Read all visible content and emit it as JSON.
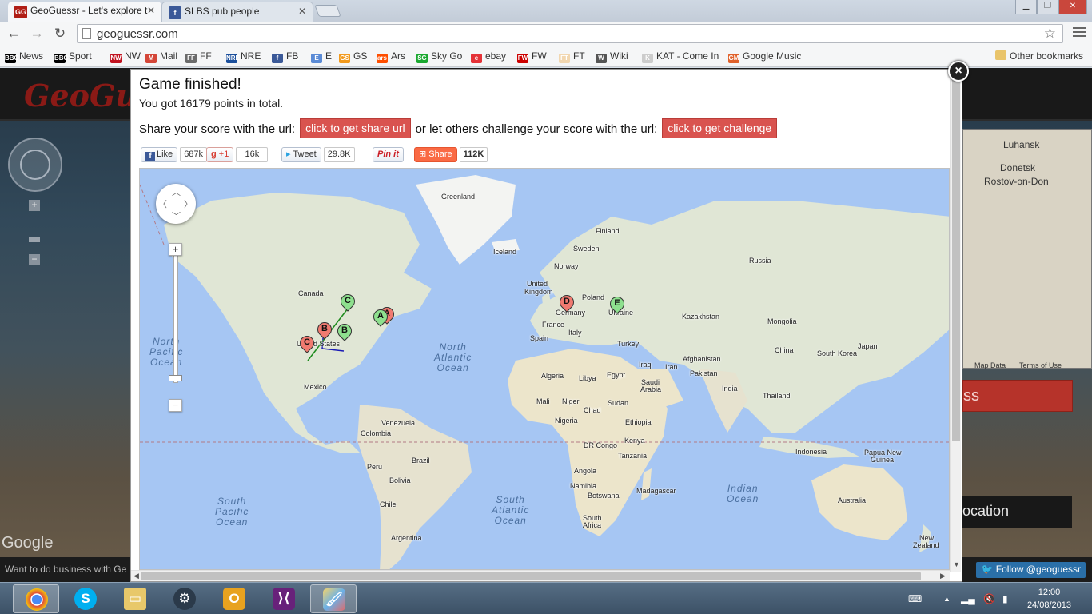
{
  "browser": {
    "tabs": [
      {
        "title": "GeoGuessr - Let's explore t",
        "favicon": "GG"
      },
      {
        "title": "SLBS pub people",
        "favicon": "f"
      }
    ],
    "url": "geoguessr.com",
    "bookmarks": [
      {
        "label": "News",
        "icon": "BBC",
        "color": "#000000"
      },
      {
        "label": "Sport",
        "icon": "BBC",
        "color": "#000000"
      },
      {
        "label": "NW",
        "icon": "NW",
        "color": "#c1121f"
      },
      {
        "label": "Mail",
        "icon": "M",
        "color": "#d44638"
      },
      {
        "label": "FF",
        "icon": "FF",
        "color": "#6b6b6b"
      },
      {
        "label": "NRE",
        "icon": "NRE",
        "color": "#1b4f9c"
      },
      {
        "label": "FB",
        "icon": "f",
        "color": "#3b5998"
      },
      {
        "label": "E",
        "icon": "E",
        "color": "#5b8bd6"
      },
      {
        "label": "GS",
        "icon": "GS",
        "color": "#f29a1d"
      },
      {
        "label": "Ars",
        "icon": "ars",
        "color": "#ff4e00"
      },
      {
        "label": "Sky Go",
        "icon": "SG",
        "color": "#1aa830"
      },
      {
        "label": "ebay",
        "icon": "e",
        "color": "#e53238"
      },
      {
        "label": "FW",
        "icon": "FW",
        "color": "#cc0000"
      },
      {
        "label": "FT",
        "icon": "FT",
        "color": "#f2d7b0"
      },
      {
        "label": "Wiki",
        "icon": "W",
        "color": "#555555"
      },
      {
        "label": "KAT - Come In",
        "icon": "K",
        "color": "#cccccc"
      },
      {
        "label": "Google Music",
        "icon": "GM",
        "color": "#e0612b"
      }
    ],
    "other_bookmarks": "Other bookmarks"
  },
  "background_page": {
    "logo": "GeoGuessr",
    "footer_text": "Want to do business with Ge",
    "follow_button": "Follow @geoguessr",
    "map_labels": [
      "Luhansk",
      "Donetsk",
      "Rostov-on-Don"
    ],
    "map_footer": [
      "Map Data",
      "Terms of Use"
    ],
    "red_button_fragment": "ss",
    "dark_button_fragment": "ocation",
    "google_watermark": "Google"
  },
  "modal": {
    "title": "Game finished!",
    "score_text": "You got 16179 points in total.",
    "share_prefix": "Share your score with the url:",
    "share_button": "click to get share url",
    "challenge_prefix": "or let others challenge your score with the url:",
    "challenge_button": "click to get challenge",
    "close_label": "×",
    "social": {
      "fb_like": "Like",
      "fb_count": "687k",
      "gplus": "+1",
      "gplus_count": "16k",
      "tweet": "Tweet",
      "tweet_count": "29.8K",
      "pinit": "Pin it",
      "share": "Share",
      "share_count": "112K"
    }
  },
  "result_map": {
    "labels": {
      "greenland": "Greenland",
      "iceland": "Iceland",
      "finland": "Finland",
      "sweden": "Sweden",
      "norway": "Norway",
      "russia": "Russia",
      "canada": "Canada",
      "united_kingdom_1": "United",
      "united_kingdom_2": "Kingdom",
      "germany": "Germany",
      "poland": "Poland",
      "ukraine": "Ukraine",
      "france": "France",
      "italy": "Italy",
      "spain": "Spain",
      "turkey": "Turkey",
      "kazakhstan": "Kazakhstan",
      "mongolia": "Mongolia",
      "china": "China",
      "south_korea": "South Korea",
      "japan": "Japan",
      "united_states": "United States",
      "mexico": "Mexico",
      "algeria": "Algeria",
      "libya": "Libya",
      "egypt": "Egypt",
      "iraq": "Iraq",
      "iran": "Iran",
      "afghanistan": "Afghanistan",
      "pakistan": "Pakistan",
      "india": "India",
      "saudi_1": "Saudi",
      "saudi_2": "Arabia",
      "thailand": "Thailand",
      "mali": "Mali",
      "niger": "Niger",
      "chad": "Chad",
      "sudan": "Sudan",
      "nigeria": "Nigeria",
      "ethiopia": "Ethiopia",
      "venezuela": "Venezuela",
      "colombia": "Colombia",
      "dr_congo": "DR Congo",
      "kenya": "Kenya",
      "tanzania": "Tanzania",
      "indonesia": "Indonesia",
      "papua_1": "Papua New",
      "papua_2": "Guinea",
      "brazil": "Brazil",
      "peru": "Peru",
      "bolivia": "Bolivia",
      "angola": "Angola",
      "namibia": "Namibia",
      "botswana": "Botswana",
      "madagascar": "Madagascar",
      "south_africa_1": "South",
      "south_africa_2": "Africa",
      "australia": "Australia",
      "chile": "Chile",
      "argentina": "Argentina",
      "new_zealand_1": "New",
      "new_zealand_2": "Zealand"
    },
    "oceans": {
      "north_pacific": "North\nPacific\nOcean",
      "north_atlantic": "North\nAtlantic\nOcean",
      "south_pacific": "South\nPacific\nOcean",
      "south_atlantic": "South\nAtlantic\nOcean",
      "indian": "Indian\nOcean"
    },
    "pins": [
      {
        "letter": "A",
        "kind": "guess",
        "color": "#f07a70"
      },
      {
        "letter": "A",
        "kind": "actual",
        "color": "#8ee08e"
      },
      {
        "letter": "B",
        "kind": "guess",
        "color": "#f07a70"
      },
      {
        "letter": "B",
        "kind": "actual",
        "color": "#8ee08e"
      },
      {
        "letter": "C",
        "kind": "guess",
        "color": "#f07a70"
      },
      {
        "letter": "C",
        "kind": "actual",
        "color": "#8ee08e"
      },
      {
        "letter": "D",
        "kind": "guess",
        "color": "#f07a70"
      },
      {
        "letter": "E",
        "kind": "actual",
        "color": "#8ee08e"
      }
    ]
  },
  "taskbar": {
    "apps": [
      "chrome-icon",
      "skype-icon",
      "explorer-icon",
      "steam-icon",
      "outlook-icon",
      "visual-studio-icon",
      "paint-icon"
    ],
    "time": "12:00",
    "date": "24/08/2013"
  }
}
